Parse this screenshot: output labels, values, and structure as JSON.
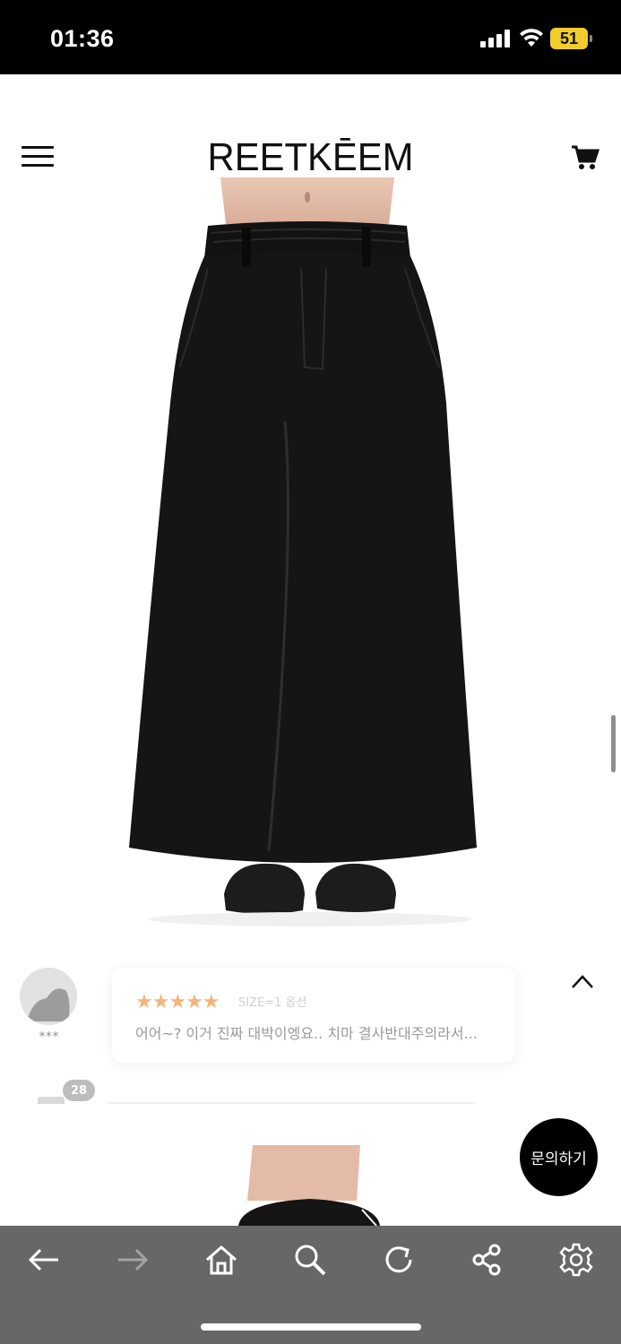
{
  "status_bar": {
    "time": "01:36",
    "battery_level": "51",
    "icons": [
      "signal-icon",
      "wifi-icon",
      "battery-icon"
    ]
  },
  "header": {
    "logo": "REETKĒEM",
    "icons": [
      "menu-icon",
      "cart-icon"
    ]
  },
  "product": {
    "image_icon": "black-long-skirt-photo"
  },
  "review": {
    "user": "***",
    "rating": 5,
    "stars": "★★★★★",
    "option": "SIZE=1 옵션",
    "text": "어어~? 이거 진짜 대박이엥요.. 치마 결사반대주의라서...",
    "count_badge": "28"
  },
  "inquiry": {
    "label": "문의하기"
  },
  "toolbar": {
    "buttons": [
      "back-icon",
      "forward-icon",
      "home-icon",
      "search-icon",
      "reload-icon",
      "share-icon",
      "settings-icon"
    ]
  },
  "colors": {
    "status_bar_bg": "#000000",
    "toolbar_bg": "#676767",
    "star_color": "#f5b47a",
    "battery": "#f2cc2a"
  }
}
